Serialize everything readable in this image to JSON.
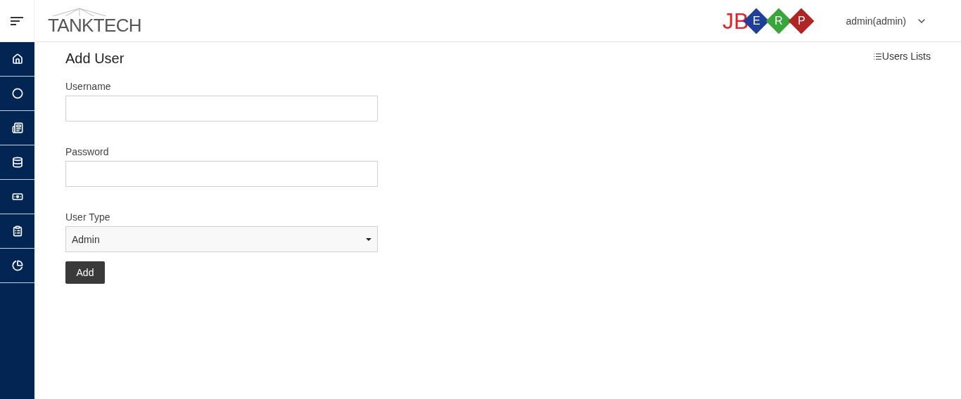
{
  "header": {
    "brand": "TANKTECH",
    "erp_logo": {
      "prefix": "JB",
      "letters": [
        {
          "text": "E",
          "color": "#1f3f9a"
        },
        {
          "text": "R",
          "color": "#3aa53a"
        },
        {
          "text": "P",
          "color": "#b02424"
        }
      ]
    },
    "user": "admin(admin)"
  },
  "page": {
    "title": "Add User",
    "link": "Users Lists",
    "fields": [
      {
        "kind": "text",
        "label": "Username"
      },
      {
        "kind": "password",
        "label": "Password"
      },
      {
        "kind": "select",
        "label": "User Type",
        "value": "Admin"
      }
    ],
    "submit": "Add"
  }
}
